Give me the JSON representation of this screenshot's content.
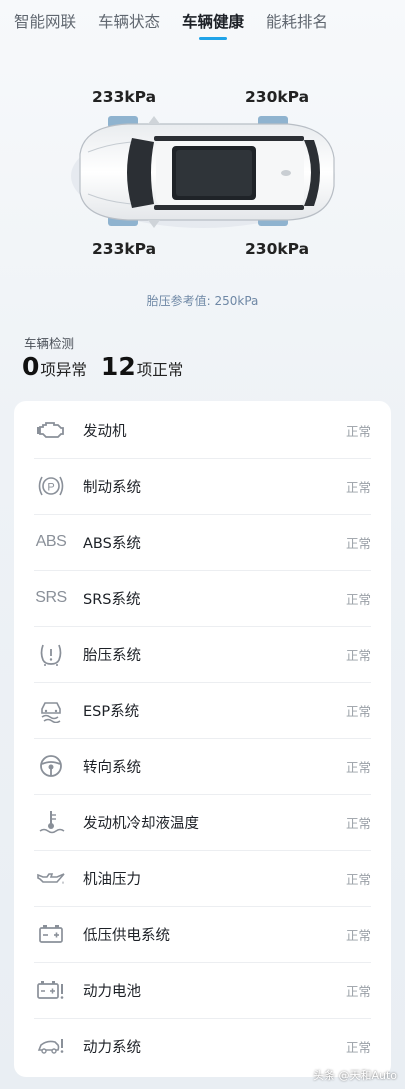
{
  "tabs": [
    {
      "label": "智能网联",
      "active": false
    },
    {
      "label": "车辆状态",
      "active": false
    },
    {
      "label": "车辆健康",
      "active": true
    },
    {
      "label": "能耗排名",
      "active": false
    }
  ],
  "tires": {
    "front_left": "233kPa",
    "front_right": "230kPa",
    "rear_left": "233kPa",
    "rear_right": "230kPa"
  },
  "reference": "胎压参考值: 250kPa",
  "summary": {
    "title": "车辆检测",
    "abnormal_count": "0",
    "abnormal_label": "项异常",
    "normal_count": "12",
    "normal_label": "项正常"
  },
  "items": [
    {
      "icon": "engine-icon",
      "name": "发动机",
      "status": "正常"
    },
    {
      "icon": "parking-brake-icon",
      "name": "制动系统",
      "status": "正常"
    },
    {
      "icon": "abs-icon",
      "icon_text": "ABS",
      "name": "ABS系统",
      "status": "正常"
    },
    {
      "icon": "srs-icon",
      "icon_text": "SRS",
      "name": "SRS系统",
      "status": "正常"
    },
    {
      "icon": "tire-pressure-icon",
      "name": "胎压系统",
      "status": "正常"
    },
    {
      "icon": "esp-icon",
      "name": "ESP系统",
      "status": "正常"
    },
    {
      "icon": "steering-wheel-icon",
      "name": "转向系统",
      "status": "正常"
    },
    {
      "icon": "coolant-temp-icon",
      "name": "发动机冷却液温度",
      "status": "正常"
    },
    {
      "icon": "oil-pressure-icon",
      "name": "机油压力",
      "status": "正常"
    },
    {
      "icon": "battery-icon",
      "name": "低压供电系统",
      "status": "正常"
    },
    {
      "icon": "power-battery-icon",
      "name": "动力电池",
      "status": "正常"
    },
    {
      "icon": "powertrain-icon",
      "name": "动力系统",
      "status": "正常"
    }
  ],
  "watermark": "头条 @天和Auto",
  "colors": {
    "accent": "#1fa3e8",
    "reference_text": "#6f88a6",
    "status_text": "#9aa0a7",
    "tire_highlight": "#8fb3cf"
  }
}
